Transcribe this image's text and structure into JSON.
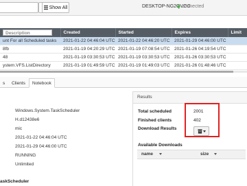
{
  "toolbar": {
    "show_all_label": "Show All",
    "hostname": "DESKTOP-NG2QVOG",
    "connection_status": "connected"
  },
  "hunts": {
    "columns": [
      "Created",
      "Started",
      "Expires",
      "Limit"
    ],
    "description_filter_placeholder": "Description",
    "rows": [
      {
        "description": "unt For all Scheduled tasks",
        "created": "2021-01-22 04:46:04 UTC",
        "started": "2021-01-22 04:46:20 UTC",
        "expires": "2021-01-29 04:46:00 UTC",
        "selected": true
      },
      {
        "description": "8fb",
        "created": "2021-01-19 04:20:29 UTC",
        "started": "2021-01-19 07:08:54 UTC",
        "expires": "2021-01-26 04:19:54 UTC",
        "selected": false
      },
      {
        "description": "48",
        "created": "2021-01-19 03:30:53 UTC",
        "started": "2021-01-19 03:30:53 UTC",
        "expires": "2021-01-26 03:30:53 UTC",
        "selected": false
      },
      {
        "description": "ystem.VFS.ListDirectory",
        "created": "2021-01-19 01:49:59 UTC",
        "started": "2021-01-19 01:49:03 UTC",
        "expires": "2021-01-26 01:48:46 UTC",
        "selected": false
      }
    ]
  },
  "tabs": [
    {
      "label": "s",
      "active": false
    },
    {
      "label": "Clients",
      "active": false
    },
    {
      "label": "Notebook",
      "active": true
    }
  ],
  "details": {
    "values": [
      "Windows.System.TaskScheduler",
      "H.d12438e6",
      "mic",
      "2021-01-22 04:46:04 UTC",
      "2021-01-29 04:46:00 UTC",
      "RUNNING",
      "Unlimited"
    ],
    "section_label": "askScheduler"
  },
  "results": {
    "title": "Results",
    "total_scheduled_label": "Total scheduled",
    "total_scheduled_value": "2001",
    "finished_clients_label": "Finished clients",
    "finished_clients_value": "402",
    "download_results_label": "Download Results",
    "available_downloads_label": "Available Downloads",
    "download_columns": [
      "name",
      "size"
    ]
  },
  "colors": {
    "connected": "#4caf50",
    "header_bg": "#555c64",
    "selected_row": "#c9dbef",
    "highlight": "#e02020"
  },
  "icons": {
    "search": "search-icon",
    "show_all": "list-icon",
    "download": "archive-icon",
    "caret": "caret-down-icon"
  }
}
